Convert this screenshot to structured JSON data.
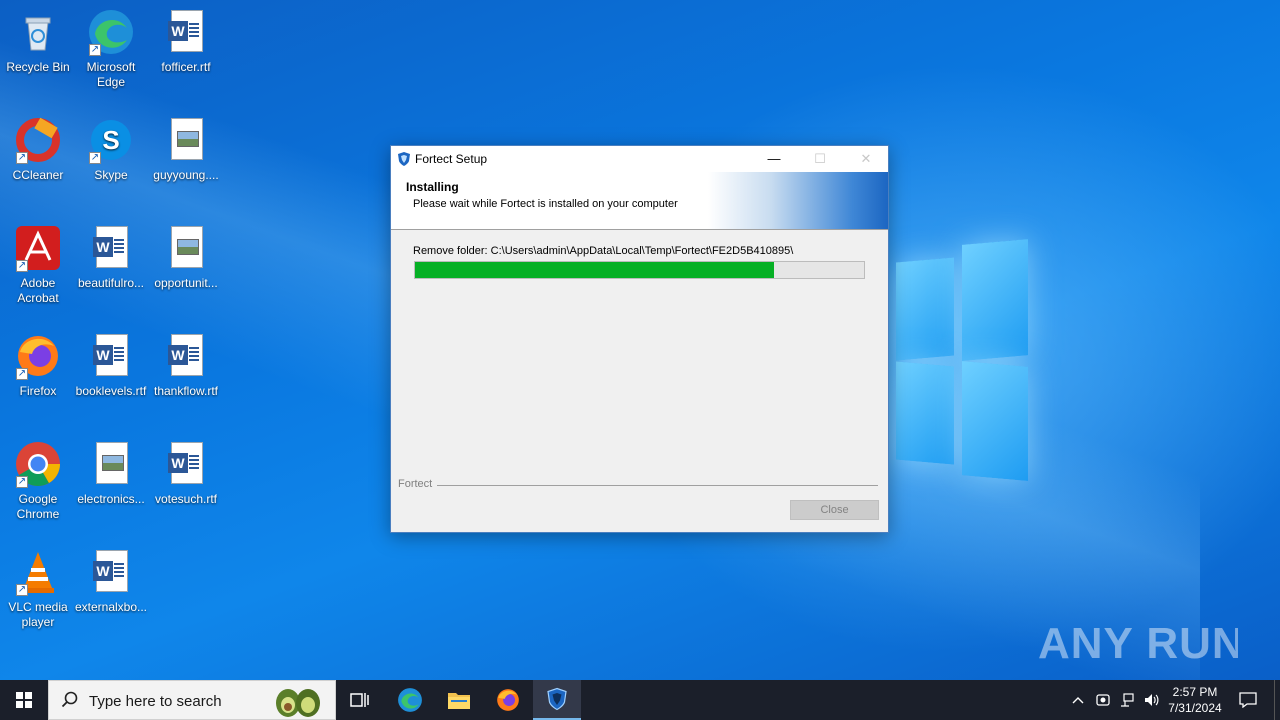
{
  "desktop": {
    "icons": [
      {
        "label": "Recycle Bin",
        "icon": "recycle-bin-icon"
      },
      {
        "label": "Microsoft Edge",
        "icon": "edge-icon"
      },
      {
        "label": "fofficer.rtf",
        "icon": "word-document-icon"
      },
      {
        "label": "CCleaner",
        "icon": "ccleaner-icon"
      },
      {
        "label": "Skype",
        "icon": "skype-icon"
      },
      {
        "label": "guyyoung....",
        "icon": "image-file-icon"
      },
      {
        "label": "Adobe Acrobat",
        "icon": "acrobat-icon"
      },
      {
        "label": "beautifulro...",
        "icon": "word-document-icon"
      },
      {
        "label": "opportunit...",
        "icon": "image-file-icon"
      },
      {
        "label": "Firefox",
        "icon": "firefox-icon"
      },
      {
        "label": "booklevels.rtf",
        "icon": "word-document-icon"
      },
      {
        "label": "thankflow.rtf",
        "icon": "word-document-icon"
      },
      {
        "label": "Google Chrome",
        "icon": "chrome-icon"
      },
      {
        "label": "electronics...",
        "icon": "image-file-icon"
      },
      {
        "label": "votesuch.rtf",
        "icon": "word-document-icon"
      },
      {
        "label": "VLC media player",
        "icon": "vlc-icon"
      },
      {
        "label": "externalxbo...",
        "icon": "word-document-icon"
      }
    ]
  },
  "setup": {
    "title": "Fortect Setup",
    "header_title": "Installing",
    "header_subtitle": "Please wait while Fortect is installed on your computer",
    "status": "Remove folder: C:\\Users\\admin\\AppData\\Local\\Temp\\Fortect\\FE2D5B410895\\",
    "progress": 0.8,
    "brand_label": "Fortect",
    "close_label": "Close",
    "minimize_glyph": "—",
    "maximize_glyph": "☐",
    "close_glyph": "✕"
  },
  "watermark": "ANY RUN",
  "taskbar": {
    "search_placeholder": "Type here to search",
    "apps": [
      "task-view-icon",
      "edge-icon",
      "file-explorer-icon",
      "firefox-icon",
      "fortect-icon"
    ],
    "clock_time": "2:57 PM",
    "clock_date": "7/31/2024"
  },
  "colors": {
    "progress_fill": "#06b025",
    "taskbar": "#1b1f2a",
    "accent": "#1c66c2"
  }
}
